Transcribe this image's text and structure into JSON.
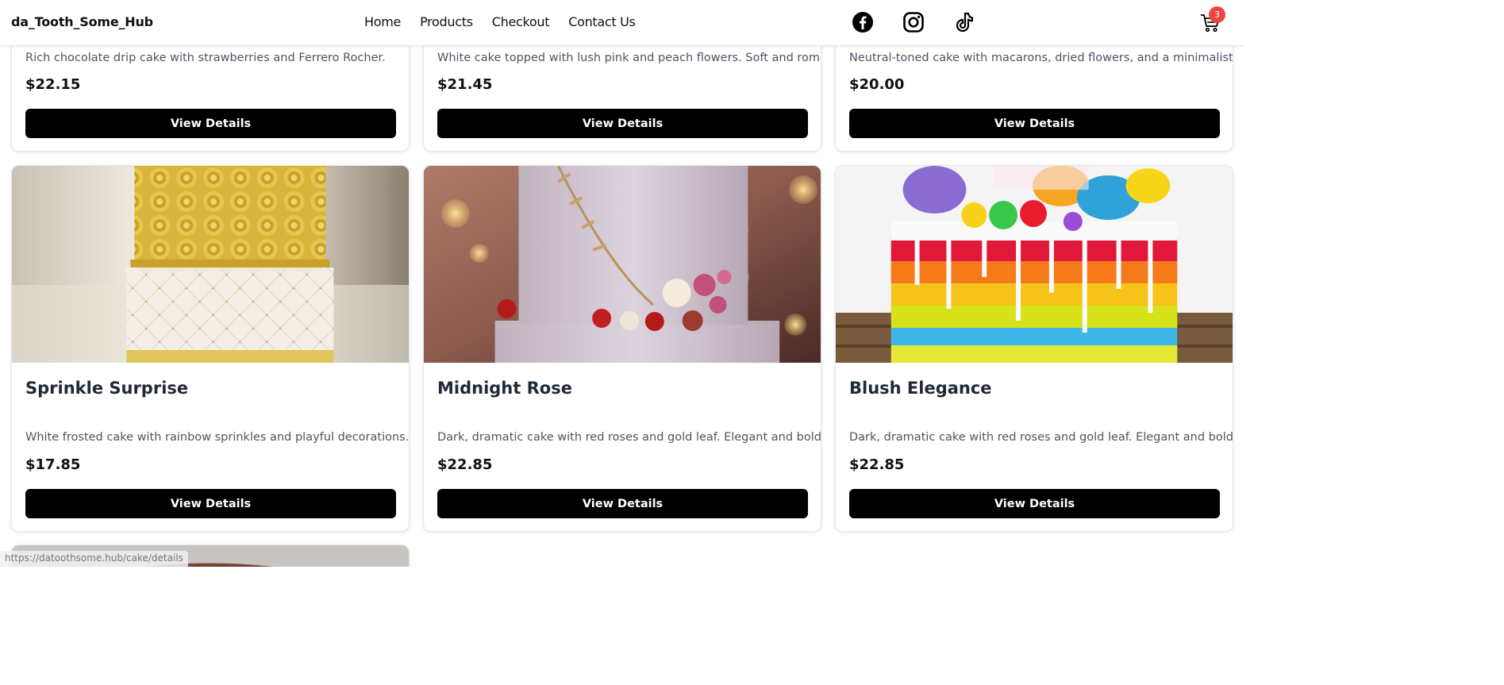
{
  "header": {
    "brand": "da_Tooth_Some_Hub",
    "nav": [
      "Home",
      "Products",
      "Checkout",
      "Contact Us"
    ],
    "social_icons": [
      "facebook-icon",
      "instagram-icon",
      "tiktok-icon"
    ],
    "cart_count": "3"
  },
  "colors": {
    "button": "#000000",
    "badge": "#ef4444",
    "text_primary": "#111827",
    "text_muted": "#4b5563"
  },
  "products_partial": [
    {
      "desc": "Rich chocolate drip cake with strawberries and Ferrero Rocher.",
      "price": "$22.15",
      "button": "View Details"
    },
    {
      "desc": "White cake topped with lush pink and peach flowers. Soft and romantic.",
      "price": "$21.45",
      "button": "View Details"
    },
    {
      "desc": "Neutral-toned cake with macarons, dried flowers, and a minimalist vibe.",
      "price": "$20.00",
      "button": "View Details"
    }
  ],
  "products": [
    {
      "title": "Sprinkle Surprise",
      "desc": "White frosted cake with rainbow sprinkles and playful decorations.",
      "price": "$17.85",
      "button": "View Details"
    },
    {
      "title": "Midnight Rose",
      "desc": "Dark, dramatic cake with red roses and gold leaf. Elegant and bold.",
      "price": "$22.85",
      "button": "View Details"
    },
    {
      "title": "Blush Elegance",
      "desc": "Dark, dramatic cake with red roses and gold leaf. Elegant and bold.",
      "price": "$22.85",
      "button": "View Details"
    }
  ],
  "status_bar_url": "https://datoothsome.hub/cake/details"
}
